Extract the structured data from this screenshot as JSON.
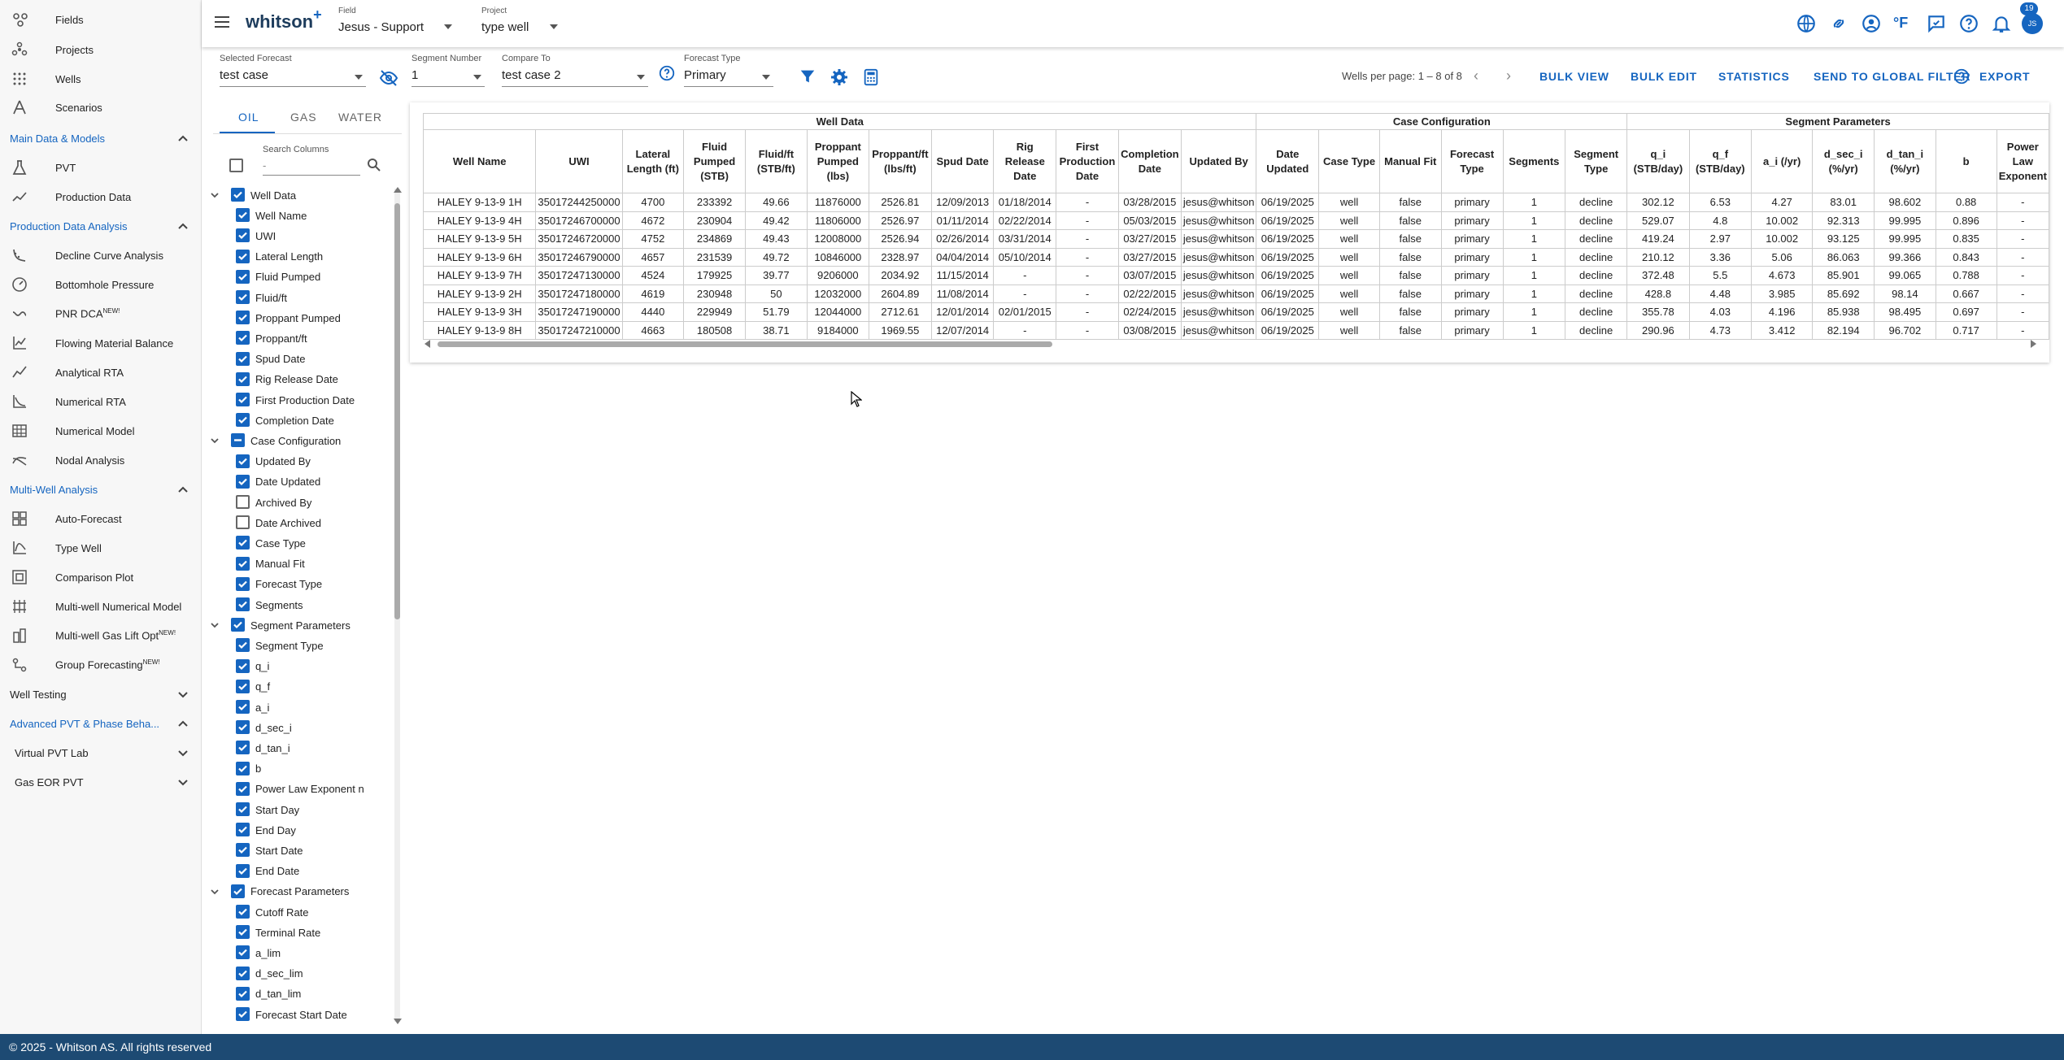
{
  "app": {
    "logo": "whitson",
    "logo_plus": "+",
    "footer": "© 2025 - Whitson AS. All rights reserved",
    "notification_count": "19",
    "avatar_initials": "JS",
    "temp_unit": "°F",
    "accent": "#1565c0"
  },
  "header": {
    "field": {
      "caption": "Field",
      "value": "Jesus - Support"
    },
    "project": {
      "caption": "Project",
      "value": "type well"
    }
  },
  "sidebar": {
    "top_items": [
      {
        "label": "Fields",
        "icon": "fields-icon"
      },
      {
        "label": "Projects",
        "icon": "projects-icon"
      },
      {
        "label": "Wells",
        "icon": "wells-icon"
      },
      {
        "label": "Scenarios",
        "icon": "scenarios-icon"
      }
    ],
    "group_main": "Main Data & Models",
    "main_items": [
      {
        "label": "PVT",
        "icon": "flask-icon"
      },
      {
        "label": "Production Data",
        "icon": "trend-icon"
      }
    ],
    "group_pda": "Production Data Analysis",
    "pda_items": [
      {
        "label": "Decline Curve Analysis",
        "icon": "decline-icon"
      },
      {
        "label": "Bottomhole Pressure",
        "icon": "gauge-icon"
      },
      {
        "label": "PNR DCA",
        "badge": "NEW!",
        "icon": "pnr-icon"
      },
      {
        "label": "Flowing Material Balance",
        "icon": "chart-icon"
      },
      {
        "label": "Analytical RTA",
        "icon": "rta-icon"
      },
      {
        "label": "Numerical RTA",
        "icon": "numrta-icon"
      },
      {
        "label": "Numerical Model",
        "icon": "grid-icon"
      },
      {
        "label": "Nodal Analysis",
        "icon": "nodal-icon"
      }
    ],
    "group_mwa": "Multi-Well Analysis",
    "mwa_items": [
      {
        "label": "Auto-Forecast",
        "icon": "autoforecast-icon"
      },
      {
        "label": "Type Well",
        "icon": "typewell-icon"
      },
      {
        "label": "Comparison Plot",
        "icon": "comparison-icon"
      },
      {
        "label": "Multi-well Numerical Model",
        "icon": "multiwell-icon"
      },
      {
        "label": "Multi-well Gas Lift Opt",
        "badge": "NEW!",
        "icon": "gaslift-icon"
      },
      {
        "label": "Group Forecasting",
        "badge": "NEW!",
        "icon": "group-icon"
      }
    ],
    "group_wt": "Well Testing",
    "group_adv": "Advanced PVT & Phase Beha...",
    "sub_vpvt": "Virtual PVT Lab",
    "sub_geor": "Gas EOR PVT"
  },
  "controls": {
    "selected_forecast": {
      "caption": "Selected Forecast",
      "value": "test case"
    },
    "segment_number": {
      "caption": "Segment Number",
      "value": "1"
    },
    "compare_to": {
      "caption": "Compare To",
      "value": "test case 2"
    },
    "forecast_type": {
      "caption": "Forecast Type",
      "value": "Primary"
    },
    "pagination": "Wells per page: 1 – 8 of 8",
    "bulk_view": "BULK VIEW",
    "bulk_edit": "BULK EDIT",
    "statistics": "STATISTICS",
    "send_to_global_filter": "SEND TO GLOBAL FILTER",
    "export": "EXPORT"
  },
  "column_panel": {
    "tabs": [
      "OIL",
      "GAS",
      "WATER"
    ],
    "search_label": "Search Columns",
    "search_value": "-",
    "tree": [
      {
        "label": "Well Data",
        "group": true,
        "state": "on"
      },
      {
        "label": "Well Name",
        "state": "on"
      },
      {
        "label": "UWI",
        "state": "on"
      },
      {
        "label": "Lateral Length",
        "state": "on"
      },
      {
        "label": "Fluid Pumped",
        "state": "on"
      },
      {
        "label": "Fluid/ft",
        "state": "on"
      },
      {
        "label": "Proppant Pumped",
        "state": "on"
      },
      {
        "label": "Proppant/ft",
        "state": "on"
      },
      {
        "label": "Spud Date",
        "state": "on"
      },
      {
        "label": "Rig Release Date",
        "state": "on"
      },
      {
        "label": "First Production Date",
        "state": "on"
      },
      {
        "label": "Completion Date",
        "state": "on"
      },
      {
        "label": "Case Configuration",
        "group": true,
        "state": "partial"
      },
      {
        "label": "Updated By",
        "state": "on"
      },
      {
        "label": "Date Updated",
        "state": "on"
      },
      {
        "label": "Archived By",
        "state": "off"
      },
      {
        "label": "Date Archived",
        "state": "off"
      },
      {
        "label": "Case Type",
        "state": "on"
      },
      {
        "label": "Manual Fit",
        "state": "on"
      },
      {
        "label": "Forecast Type",
        "state": "on"
      },
      {
        "label": "Segments",
        "state": "on"
      },
      {
        "label": "Segment Parameters",
        "group": true,
        "state": "on"
      },
      {
        "label": "Segment Type",
        "state": "on"
      },
      {
        "label": "q_i",
        "state": "on"
      },
      {
        "label": "q_f",
        "state": "on"
      },
      {
        "label": "a_i",
        "state": "on"
      },
      {
        "label": "d_sec_i",
        "state": "on"
      },
      {
        "label": "d_tan_i",
        "state": "on"
      },
      {
        "label": "b",
        "state": "on"
      },
      {
        "label": "Power Law Exponent n",
        "state": "on"
      },
      {
        "label": "Start Day",
        "state": "on"
      },
      {
        "label": "End Day",
        "state": "on"
      },
      {
        "label": "Start Date",
        "state": "on"
      },
      {
        "label": "End Date",
        "state": "on"
      },
      {
        "label": "Forecast Parameters",
        "group": true,
        "state": "on"
      },
      {
        "label": "Cutoff Rate",
        "state": "on"
      },
      {
        "label": "Terminal Rate",
        "state": "on"
      },
      {
        "label": "a_lim",
        "state": "on"
      },
      {
        "label": "d_sec_lim",
        "state": "on"
      },
      {
        "label": "d_tan_lim",
        "state": "on"
      },
      {
        "label": "Forecast Start Date",
        "state": "on"
      }
    ]
  },
  "table": {
    "groups": [
      {
        "label": "Well Data",
        "span": 12
      },
      {
        "label": "Case Configuration",
        "span": 6
      },
      {
        "label": "Segment Parameters",
        "span": 8
      }
    ],
    "columns": [
      "Well Name",
      "UWI",
      "Lateral Length (ft)",
      "Fluid Pumped (STB)",
      "Fluid/ft (STB/ft)",
      "Proppant Pumped (lbs)",
      "Proppant/ft (lbs/ft)",
      "Spud Date",
      "Rig Release Date",
      "First Production Date",
      "Completion Date",
      "Updated By",
      "Date Updated",
      "Case Type",
      "Manual Fit",
      "Forecast Type",
      "Segments",
      "Segment Type",
      "q_i (STB/day)",
      "q_f (STB/day)",
      "a_i (/yr)",
      "d_sec_i (%/yr)",
      "d_tan_i (%/yr)",
      "b",
      "Power Law Exponent"
    ],
    "rows": [
      [
        "HALEY 9-13-9 1H",
        "35017244250000",
        "4700",
        "233392",
        "49.66",
        "11876000",
        "2526.81",
        "12/09/2013",
        "01/18/2014",
        "-",
        "03/28/2015",
        "jesus@whitson",
        "06/19/2025",
        "well",
        "false",
        "primary",
        "1",
        "decline",
        "302.12",
        "6.53",
        "4.27",
        "83.01",
        "98.602",
        "0.88",
        "-"
      ],
      [
        "HALEY 9-13-9 4H",
        "35017246700000",
        "4672",
        "230904",
        "49.42",
        "11806000",
        "2526.97",
        "01/11/2014",
        "02/22/2014",
        "-",
        "05/03/2015",
        "jesus@whitson",
        "06/19/2025",
        "well",
        "false",
        "primary",
        "1",
        "decline",
        "529.07",
        "4.8",
        "10.002",
        "92.313",
        "99.995",
        "0.896",
        "-"
      ],
      [
        "HALEY 9-13-9 5H",
        "35017246720000",
        "4752",
        "234869",
        "49.43",
        "12008000",
        "2526.94",
        "02/26/2014",
        "03/31/2014",
        "-",
        "03/27/2015",
        "jesus@whitson",
        "06/19/2025",
        "well",
        "false",
        "primary",
        "1",
        "decline",
        "419.24",
        "2.97",
        "10.002",
        "93.125",
        "99.995",
        "0.835",
        "-"
      ],
      [
        "HALEY 9-13-9 6H",
        "35017246790000",
        "4657",
        "231539",
        "49.72",
        "10846000",
        "2328.97",
        "04/04/2014",
        "05/10/2014",
        "-",
        "03/27/2015",
        "jesus@whitson",
        "06/19/2025",
        "well",
        "false",
        "primary",
        "1",
        "decline",
        "210.12",
        "3.36",
        "5.06",
        "86.063",
        "99.366",
        "0.843",
        "-"
      ],
      [
        "HALEY 9-13-9 7H",
        "35017247130000",
        "4524",
        "179925",
        "39.77",
        "9206000",
        "2034.92",
        "11/15/2014",
        "-",
        "-",
        "03/07/2015",
        "jesus@whitson",
        "06/19/2025",
        "well",
        "false",
        "primary",
        "1",
        "decline",
        "372.48",
        "5.5",
        "4.673",
        "85.901",
        "99.065",
        "0.788",
        "-"
      ],
      [
        "HALEY 9-13-9 2H",
        "35017247180000",
        "4619",
        "230948",
        "50",
        "12032000",
        "2604.89",
        "11/08/2014",
        "-",
        "-",
        "02/22/2015",
        "jesus@whitson",
        "06/19/2025",
        "well",
        "false",
        "primary",
        "1",
        "decline",
        "428.8",
        "4.48",
        "3.985",
        "85.692",
        "98.14",
        "0.667",
        "-"
      ],
      [
        "HALEY 9-13-9 3H",
        "35017247190000",
        "4440",
        "229949",
        "51.79",
        "12044000",
        "2712.61",
        "12/01/2014",
        "02/01/2015",
        "-",
        "02/24/2015",
        "jesus@whitson",
        "06/19/2025",
        "well",
        "false",
        "primary",
        "1",
        "decline",
        "355.78",
        "4.03",
        "4.196",
        "85.938",
        "98.495",
        "0.697",
        "-"
      ],
      [
        "HALEY 9-13-9 8H",
        "35017247210000",
        "4663",
        "180508",
        "38.71",
        "9184000",
        "1969.55",
        "12/07/2014",
        "-",
        "-",
        "03/08/2015",
        "jesus@whitson",
        "06/19/2025",
        "well",
        "false",
        "primary",
        "1",
        "decline",
        "290.96",
        "4.73",
        "3.412",
        "82.194",
        "96.702",
        "0.717",
        "-"
      ]
    ]
  }
}
